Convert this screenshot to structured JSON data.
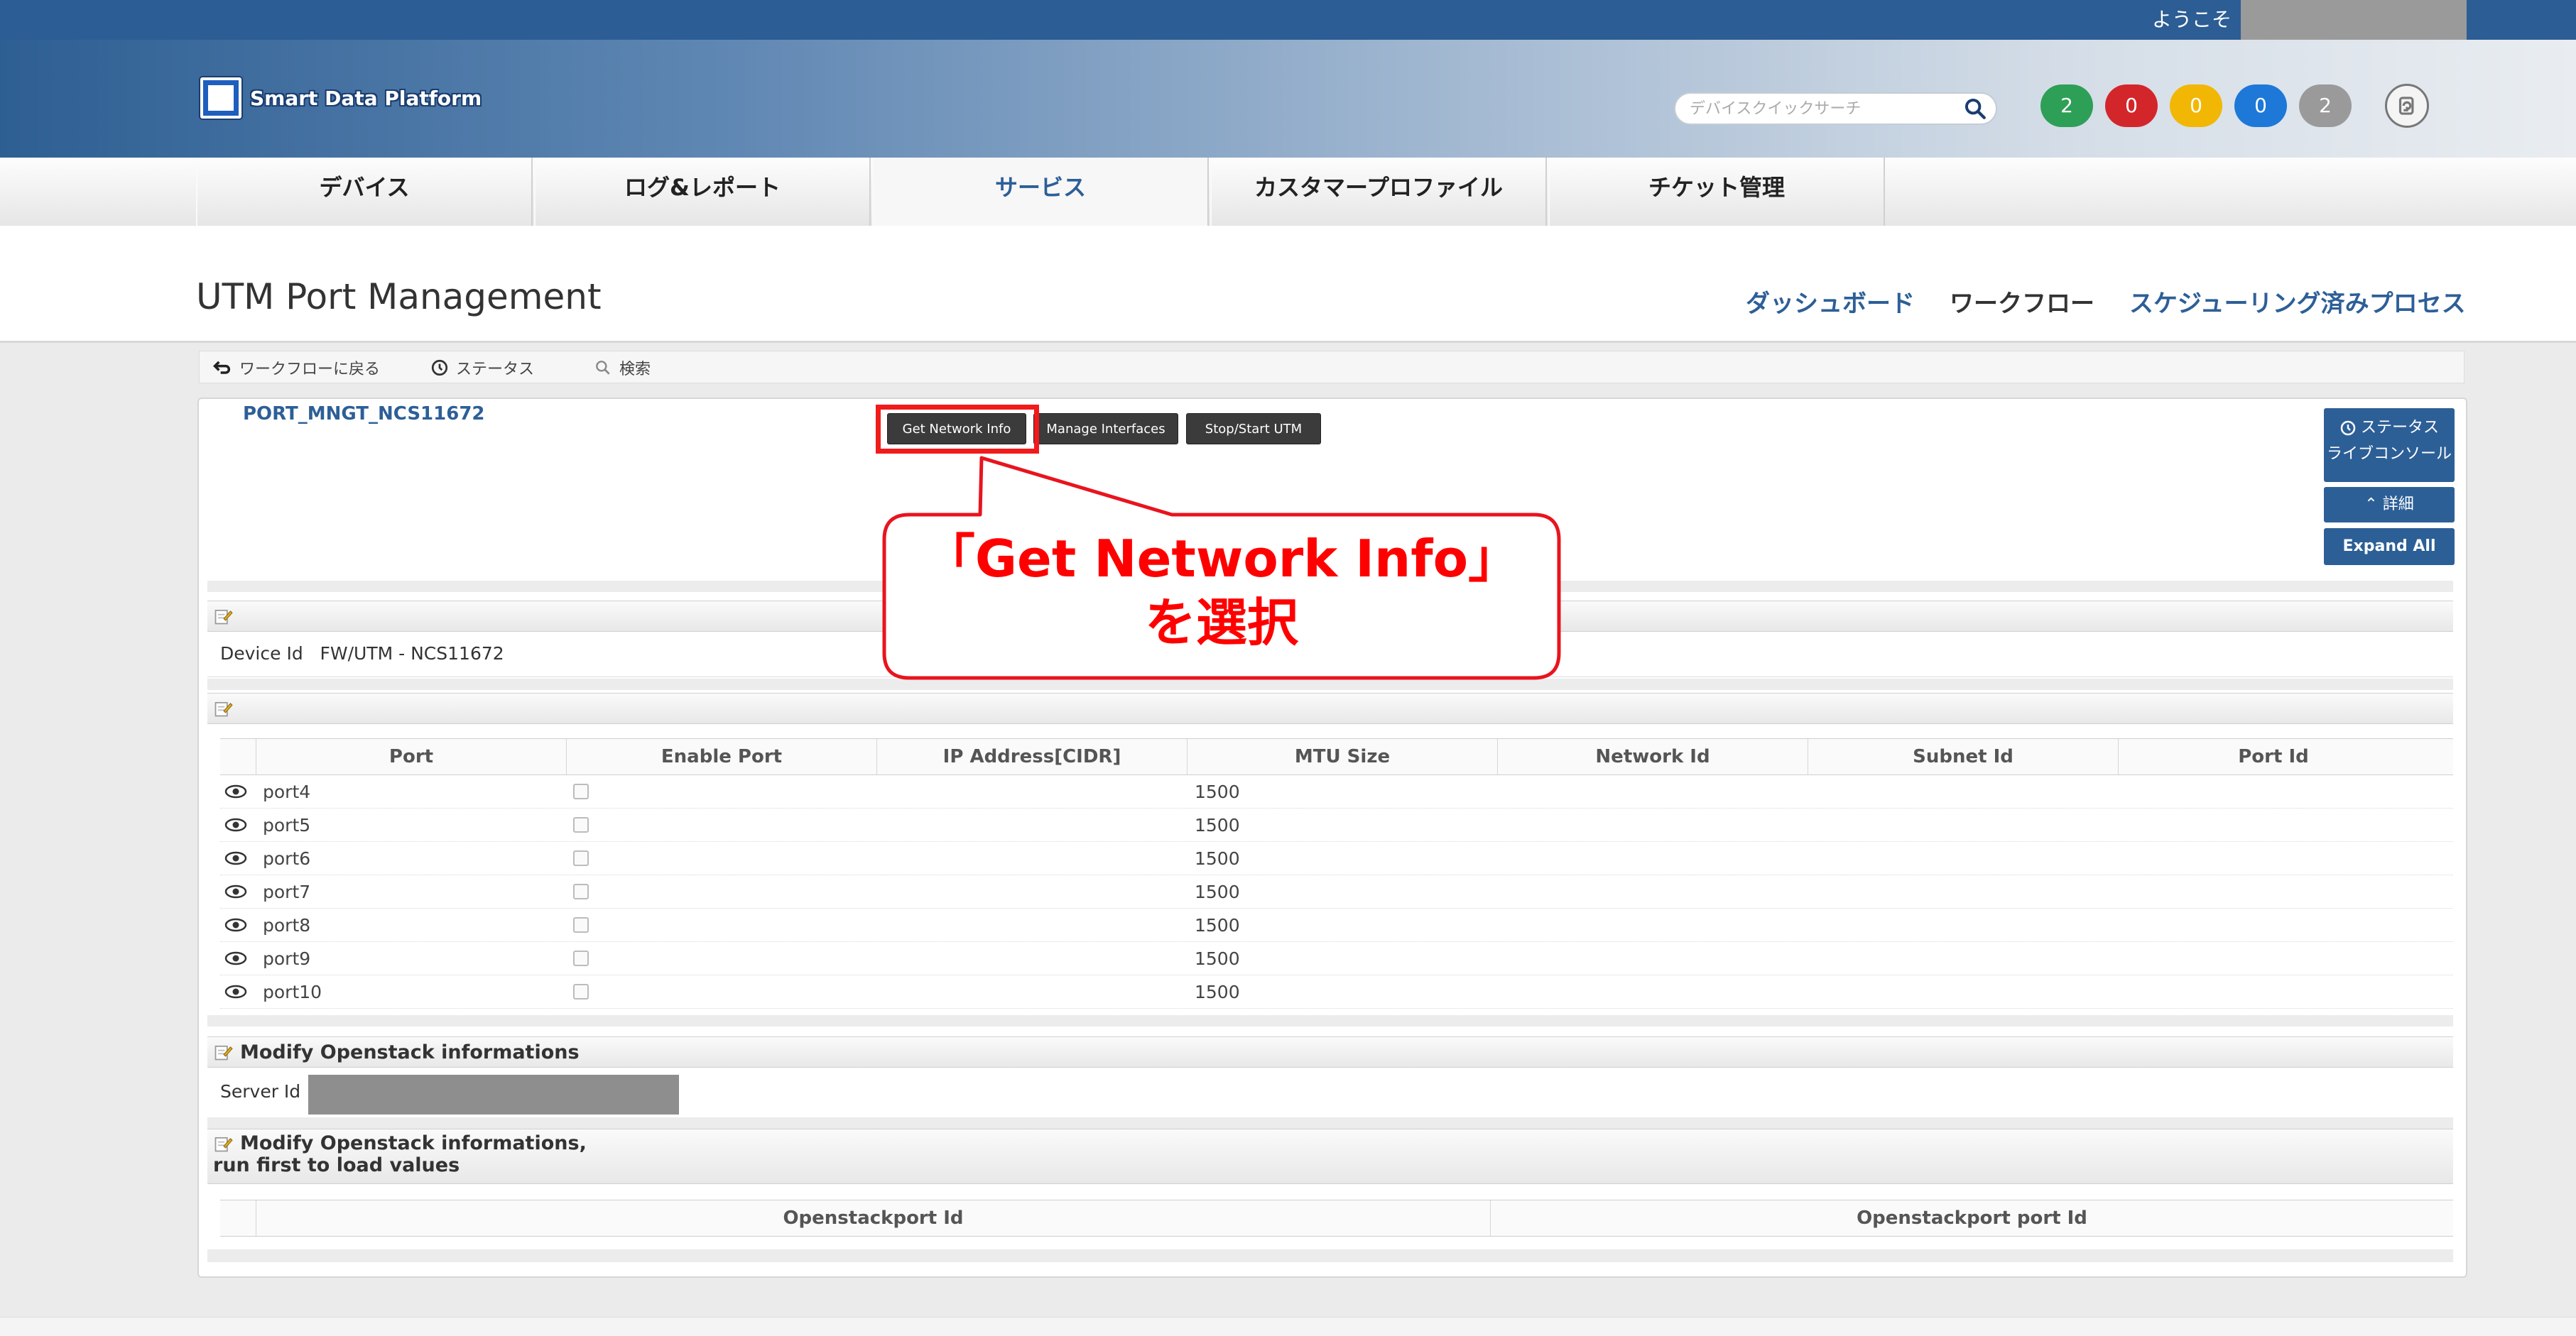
{
  "header": {
    "welcome": "ようこそ",
    "logo_text": "Smart Data Platform",
    "search_placeholder": "デバイスクイックサーチ",
    "badges": [
      {
        "label": "2",
        "color": "#2e9f57"
      },
      {
        "label": "0",
        "color": "#d3262b"
      },
      {
        "label": "0",
        "color": "#f2b705"
      },
      {
        "label": "0",
        "color": "#1d78d8"
      },
      {
        "label": "2",
        "color": "#9a9a9a"
      }
    ]
  },
  "nav": {
    "tabs": [
      {
        "label": "デバイス"
      },
      {
        "label": "ログ&レポート"
      },
      {
        "label": "サービス",
        "active": true
      },
      {
        "label": "カスタマープロファイル"
      },
      {
        "label": "チケット管理"
      }
    ]
  },
  "page": {
    "title": "UTM Port Management",
    "links": [
      "ダッシュボード",
      "ワークフロー",
      "スケジューリング済みプロセス"
    ]
  },
  "toolbar": {
    "back": "ワークフローに戻る",
    "status": "ステータス",
    "search": "検索"
  },
  "process": {
    "name": "PORT_MNGT_NCS11672",
    "actions": [
      "Get Network Info",
      "Manage Interfaces",
      "Stop/Start UTM"
    ]
  },
  "side_buttons": {
    "status": "ステータス",
    "live_console": "ライブコンソール",
    "details": "詳細",
    "expand_all": "Expand All"
  },
  "device": {
    "label": "Device Id",
    "value": "FW/UTM - NCS11672"
  },
  "ports_table": {
    "columns": [
      "Port",
      "Enable Port",
      "IP Address[CIDR]",
      "MTU Size",
      "Network Id",
      "Subnet Id",
      "Port Id"
    ],
    "rows": [
      {
        "port": "port4",
        "mtu": "1500"
      },
      {
        "port": "port5",
        "mtu": "1500"
      },
      {
        "port": "port6",
        "mtu": "1500"
      },
      {
        "port": "port7",
        "mtu": "1500"
      },
      {
        "port": "port8",
        "mtu": "1500"
      },
      {
        "port": "port9",
        "mtu": "1500"
      },
      {
        "port": "port10",
        "mtu": "1500"
      }
    ]
  },
  "openstack": {
    "section_title": "Modify Openstack informations",
    "server_label": "Server Id",
    "section2_title_line1": "Modify Openstack informations,",
    "section2_title_line2": "run first to load values",
    "columns": [
      "Openstackport Id",
      "Openstackport port Id"
    ]
  },
  "callout": {
    "line1": "「Get Network Info」",
    "line2": "を選択"
  }
}
